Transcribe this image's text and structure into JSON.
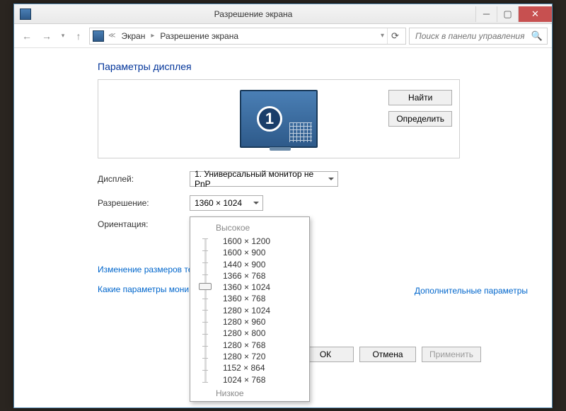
{
  "window": {
    "title": "Разрешение экрана"
  },
  "breadcrumb": {
    "item1": "Экран",
    "item2": "Разрешение экрана"
  },
  "search": {
    "placeholder": "Поиск в панели управления"
  },
  "section": {
    "title": "Параметры дисплея"
  },
  "monitor": {
    "number": "1"
  },
  "panel_buttons": {
    "find": "Найти",
    "detect": "Определить"
  },
  "form": {
    "display_label": "Дисплей:",
    "display_value": "1. Универсальный монитор не PnP",
    "resolution_label": "Разрешение:",
    "resolution_value": "1360 × 1024",
    "orientation_label": "Ориентация:"
  },
  "links": {
    "advanced": "Дополнительные параметры",
    "resize": "Изменение размеров те",
    "which": "Какие параметры мони"
  },
  "buttons": {
    "ok": "ОК",
    "cancel": "Отмена",
    "apply": "Применить"
  },
  "dropdown": {
    "top_label": "Высокое",
    "bottom_label": "Низкое",
    "selected_index": 4,
    "options": [
      "1600 × 1200",
      "1600 × 900",
      "1440 × 900",
      "1366 × 768",
      "1360 × 1024",
      "1360 × 768",
      "1280 × 1024",
      "1280 × 960",
      "1280 × 800",
      "1280 × 768",
      "1280 × 720",
      "1152 × 864",
      "1024 × 768"
    ]
  }
}
